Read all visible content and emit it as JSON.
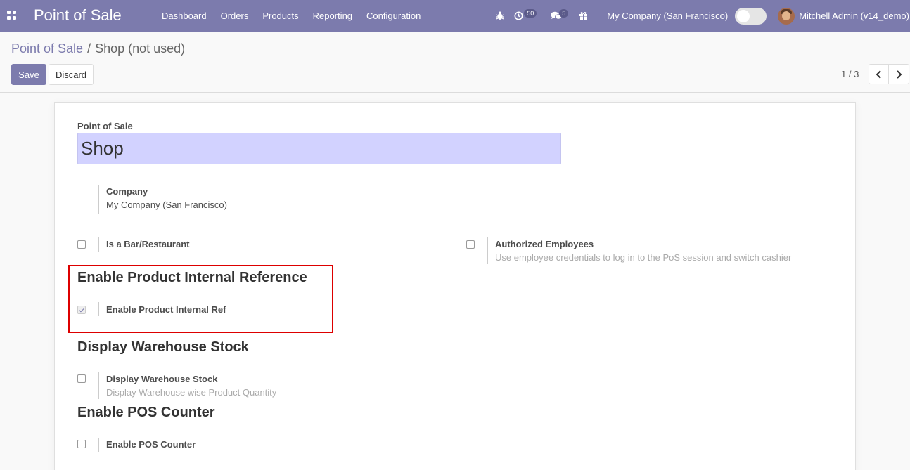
{
  "navbar": {
    "apps_icon": "grid-icon",
    "app_title": "Point of Sale",
    "menu": [
      "Dashboard",
      "Orders",
      "Products",
      "Reporting",
      "Configuration"
    ],
    "activity_count": "50",
    "messages_count": "5",
    "company": "My Company (San Francisco)",
    "user": "Mitchell Admin (v14_demo)",
    "colors": {
      "brand": "#7c7bad"
    }
  },
  "breadcrumb": {
    "parent": "Point of Sale",
    "separator": "/",
    "current": "Shop (not used)"
  },
  "actions": {
    "save": "Save",
    "discard": "Discard"
  },
  "pager": {
    "value": "1 / 3"
  },
  "form": {
    "name_label": "Point of Sale",
    "name_value": "Shop",
    "company_label": "Company",
    "company_value": "My Company (San Francisco)",
    "bar_restaurant_label": "Is a Bar/Restaurant",
    "bar_restaurant_checked": false,
    "authorized_label": "Authorized Employees",
    "authorized_help": "Use employee credentials to log in to the PoS session and switch cashier",
    "authorized_checked": false,
    "internal_ref_title": "Enable Product Internal Reference",
    "internal_ref_label": "Enable Product Internal Ref",
    "internal_ref_checked": true,
    "warehouse_title": "Display Warehouse Stock",
    "warehouse_label": "Display Warehouse Stock",
    "warehouse_help": "Display Warehouse wise Product Quantity",
    "warehouse_checked": false,
    "pos_counter_title": "Enable POS Counter",
    "pos_counter_label": "Enable POS Counter",
    "pos_counter_checked": false
  }
}
